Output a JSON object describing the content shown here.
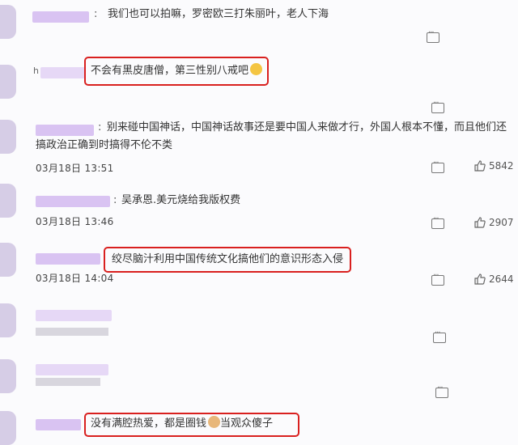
{
  "comments": [
    {
      "text": "我们也可以拍嘛，罗密欧三打朱丽叶，老人下海"
    },
    {
      "username_letter": "h",
      "text": "不会有黑皮唐僧，第三性别八戒吧"
    },
    {
      "text": "别来碰中国神话，中国神话故事还是要中国人来做才行，外国人根本不懂，而且他们还搞政治正确到时搞得不伦不类",
      "date": "03月18日 13:51",
      "likes": "5842"
    },
    {
      "text": "吴承恩.美元烧给我版权费",
      "date": "03月18日 13:46",
      "likes": "2907"
    },
    {
      "text": "绞尽脑汁利用中国传统文化搞他们的意识形态入侵",
      "date": "03月18日 14:04",
      "likes": "2644"
    },
    {
      "text": "没有满腔热爱，都是圈钱",
      "text_after_emoji": "当观众傻子"
    }
  ],
  "colon": ":",
  "colors": {
    "highlight": "#d9201f",
    "username_blur": "#d9c3f2"
  }
}
